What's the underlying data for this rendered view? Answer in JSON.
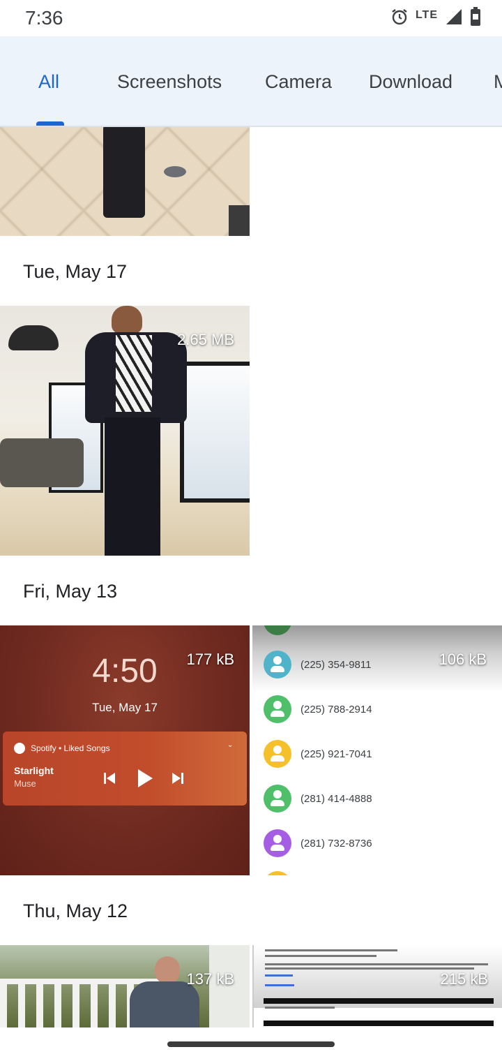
{
  "status_bar": {
    "time": "7:36",
    "network": "LTE"
  },
  "tabs": [
    {
      "label": "All",
      "active": true
    },
    {
      "label": "Screenshots",
      "active": false
    },
    {
      "label": "Camera",
      "active": false
    },
    {
      "label": "Download",
      "active": false
    },
    {
      "label": "M",
      "active": false
    }
  ],
  "groups": [
    {
      "date": "Tue, May 17",
      "items": [
        {
          "size": "2.65 MB"
        }
      ]
    },
    {
      "date": "Fri, May 13",
      "items": [
        {
          "size": "177 kB"
        },
        {
          "size": "106 kB"
        }
      ]
    },
    {
      "date": "Thu, May 12",
      "items": [
        {
          "size": "137 kB"
        },
        {
          "size": "215 kB"
        }
      ]
    }
  ],
  "lockscreen": {
    "time": "4:50",
    "date": "Tue, May 17",
    "source": "Spotify • Liked Songs",
    "track": "Starlight",
    "artist": "Muse"
  },
  "contacts": [
    {
      "number": "(225) 354-9811",
      "color": "#4fb3c9"
    },
    {
      "number": "(225) 788-2914",
      "color": "#4fbf6a"
    },
    {
      "number": "(225) 921-7041",
      "color": "#f6c02a"
    },
    {
      "number": "(281) 414-4888",
      "color": "#4fbf6a"
    },
    {
      "number": "(281) 732-8736",
      "color": "#a45de3"
    }
  ],
  "colors": {
    "accent": "#1a66d2",
    "tab_bar": "#edf3fa"
  }
}
